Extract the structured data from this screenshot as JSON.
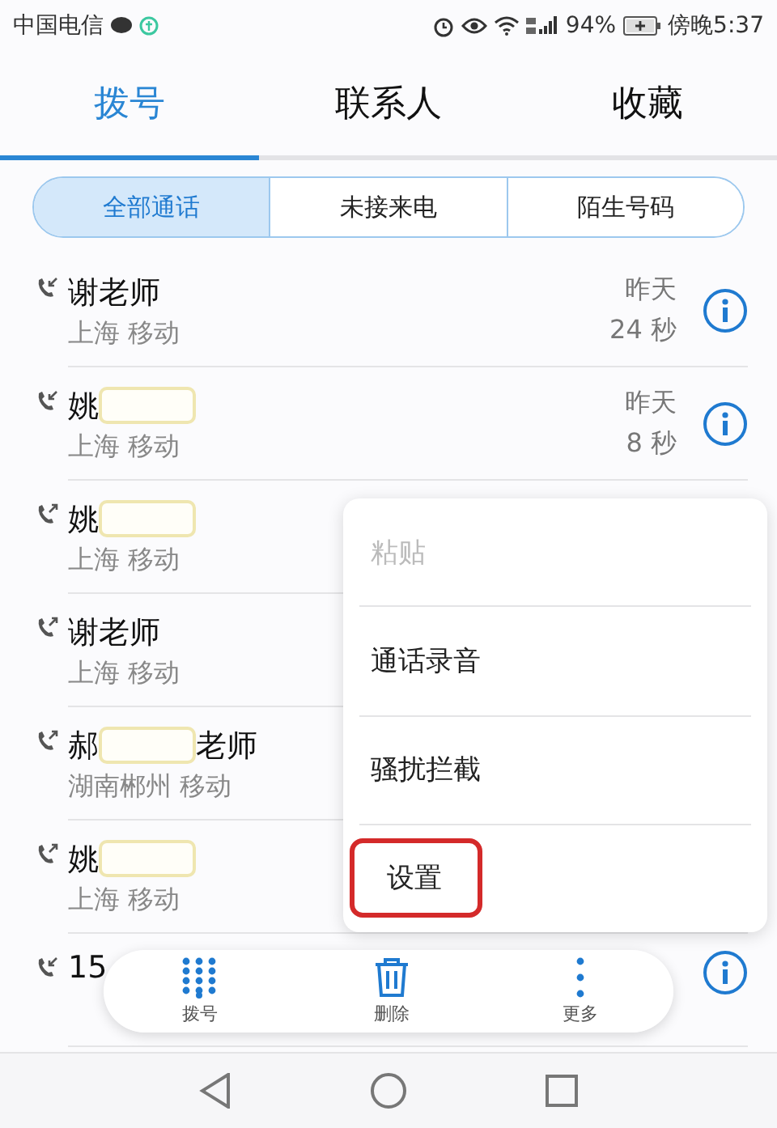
{
  "status_bar": {
    "carrier": "中国电信",
    "battery": "94%",
    "time": "傍晚5:37"
  },
  "tabs": [
    {
      "label": "拨号",
      "selected": true
    },
    {
      "label": "联系人",
      "selected": false
    },
    {
      "label": "收藏",
      "selected": false
    }
  ],
  "filter": [
    {
      "label": "全部通话",
      "selected": true
    },
    {
      "label": "未接来电",
      "selected": false
    },
    {
      "label": "陌生号码",
      "selected": false
    }
  ],
  "calls": [
    {
      "name": "谢老师",
      "redacted": false,
      "kind": "incoming",
      "location": "上海 移动",
      "date": "昨天",
      "duration": "24 秒"
    },
    {
      "name": "姚",
      "redacted": true,
      "kind": "incoming",
      "location": "上海 移动",
      "date": "昨天",
      "duration": "8 秒"
    },
    {
      "name": "姚",
      "redacted": true,
      "kind": "outgoing",
      "location": "上海 移动"
    },
    {
      "name": "谢老师",
      "redacted": false,
      "kind": "outgoing",
      "location": "上海 移动"
    },
    {
      "name": "郝",
      "redacted": true,
      "name_suffix": "老师",
      "kind": "outgoing",
      "location": "湖南郴州 移动"
    },
    {
      "name": "姚",
      "redacted": true,
      "kind": "outgoing",
      "location": "上海 移动"
    },
    {
      "name": "15",
      "redacted": false,
      "kind": "incoming"
    }
  ],
  "menu": [
    {
      "label": "粘贴",
      "disabled": true,
      "highlighted": false
    },
    {
      "label": "通话录音",
      "disabled": false,
      "highlighted": false
    },
    {
      "label": "骚扰拦截",
      "disabled": false,
      "highlighted": false
    },
    {
      "label": "设置",
      "disabled": false,
      "highlighted": true
    }
  ],
  "toolbar": [
    {
      "kind": "dialpad",
      "label": "拨号"
    },
    {
      "kind": "delete",
      "label": "删除"
    },
    {
      "kind": "more",
      "label": "更多"
    }
  ]
}
